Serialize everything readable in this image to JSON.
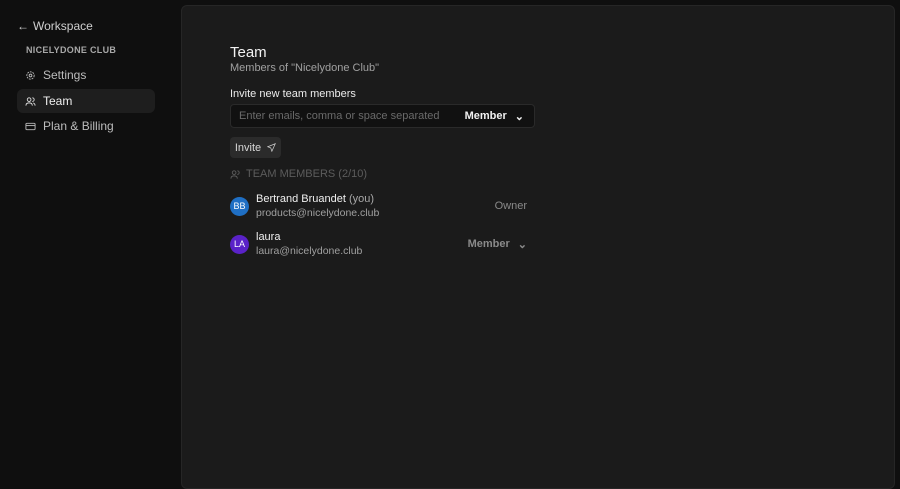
{
  "sidebar": {
    "back_label": "Workspace",
    "org_name": "NICELYDONE CLUB",
    "items": [
      {
        "label": "Settings",
        "icon": "gear-icon"
      },
      {
        "label": "Team",
        "icon": "users-icon",
        "active": true
      },
      {
        "label": "Plan & Billing",
        "icon": "credit-card-icon"
      }
    ]
  },
  "main": {
    "title": "Team",
    "subtitle": "Members of \"Nicelydone Club\"",
    "invite_label": "Invite new team members",
    "invite_placeholder": "Enter emails, comma or space separated",
    "invite_role": "Member",
    "invite_button": "Invite",
    "members_header": "TEAM MEMBERS (2/10)",
    "members": [
      {
        "initials": "BB",
        "name": "Bertrand Bruandet",
        "suffix": "(you)",
        "email": "products@nicelydone.club",
        "role": "Owner",
        "avatar_color": "#1f6fc4"
      },
      {
        "initials": "LA",
        "name": "laura",
        "suffix": "",
        "email": "laura@nicelydone.club",
        "role": "Member",
        "avatar_color": "#5a22c8"
      }
    ]
  }
}
